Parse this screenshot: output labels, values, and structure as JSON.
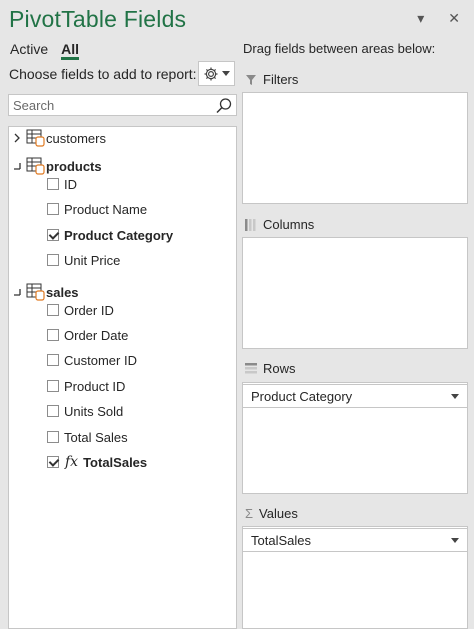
{
  "panel": {
    "title": "PivotTable Fields",
    "menu_glyph": "▾",
    "close_glyph": "✕"
  },
  "tabs": [
    {
      "label": "Active",
      "active": false
    },
    {
      "label": "All",
      "active": true
    }
  ],
  "choose_label": "Choose fields to add to report:",
  "search": {
    "placeholder": "Search",
    "value": ""
  },
  "field_tree": [
    {
      "name": "customers",
      "expanded": false,
      "bold": false
    },
    {
      "name": "products",
      "expanded": true,
      "bold": true,
      "fields": [
        {
          "label": "ID",
          "checked": false
        },
        {
          "label": "Product Name",
          "checked": false
        },
        {
          "label": "Product Category",
          "checked": true
        },
        {
          "label": "Unit Price",
          "checked": false
        }
      ]
    },
    {
      "name": "sales",
      "expanded": true,
      "bold": true,
      "fields": [
        {
          "label": "Order ID",
          "checked": false
        },
        {
          "label": "Order Date",
          "checked": false
        },
        {
          "label": "Customer ID",
          "checked": false
        },
        {
          "label": "Product ID",
          "checked": false
        },
        {
          "label": "Units Sold",
          "checked": false
        },
        {
          "label": "Total Sales",
          "checked": false
        },
        {
          "label": "TotalSales",
          "checked": true,
          "measure_symbol": "fx"
        }
      ]
    }
  ],
  "drag_hint": "Drag fields between areas below:",
  "areas": [
    {
      "title": "Filters",
      "icon": "filter-icon",
      "items": []
    },
    {
      "title": "Columns",
      "icon": "columns-icon",
      "items": []
    },
    {
      "title": "Rows",
      "icon": "rows-icon",
      "items": [
        "Product Category"
      ]
    },
    {
      "title": "Values",
      "icon": "sigma-icon",
      "symbol": "Σ",
      "items": [
        "TotalSales"
      ]
    }
  ],
  "colors": {
    "accent": "#217346",
    "panel_bg": "#e6e6e6",
    "box_border": "#c6c6c6"
  }
}
